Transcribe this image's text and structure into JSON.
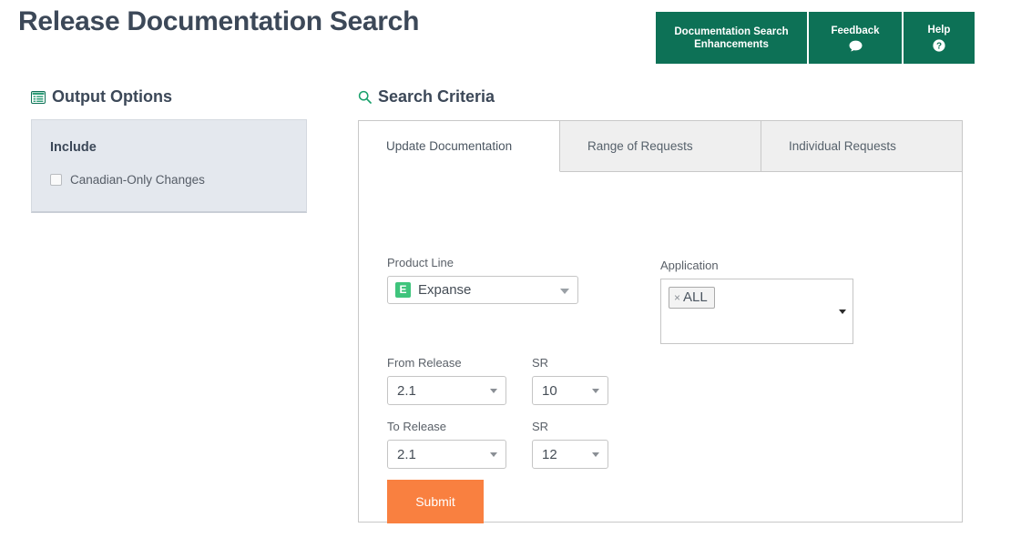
{
  "header": {
    "title": "Release Documentation Search",
    "buttons": [
      {
        "label": "Documentation Search Enhancements",
        "icon": ""
      },
      {
        "label": "Feedback",
        "icon": "comment-icon"
      },
      {
        "label": "Help",
        "icon": "question-circle-icon"
      }
    ]
  },
  "colors": {
    "header_button_bg": "#0d7156",
    "title_text": "#3c4858",
    "accent_green": "#0d7156",
    "submit_orange": "#f98040",
    "product_icon_green": "#3fc47c",
    "card_bg": "#e4e8ee"
  },
  "output_options": {
    "heading": "Output Options",
    "heading_icon": "list-alt-icon",
    "card": {
      "title": "Include",
      "checkboxes": [
        {
          "label": "Canadian-Only Changes",
          "checked": false
        }
      ]
    }
  },
  "search_criteria": {
    "heading": "Search Criteria",
    "heading_icon": "search-icon",
    "tabs": [
      {
        "label": "Update Documentation",
        "active": true
      },
      {
        "label": "Range of Requests",
        "active": false
      },
      {
        "label": "Individual Requests",
        "active": false
      }
    ],
    "fields": {
      "product_line": {
        "label": "Product Line",
        "value": "Expanse",
        "icon_letter": "E"
      },
      "application": {
        "label": "Application",
        "tags": [
          "ALL"
        ],
        "remove_glyph": "×"
      },
      "from_release": {
        "label": "From Release",
        "value": "2.1"
      },
      "from_sr": {
        "label": "SR",
        "value": "10"
      },
      "to_release": {
        "label": "To Release",
        "value": "2.1"
      },
      "to_sr": {
        "label": "SR",
        "value": "12"
      }
    },
    "submit_label": "Submit"
  }
}
